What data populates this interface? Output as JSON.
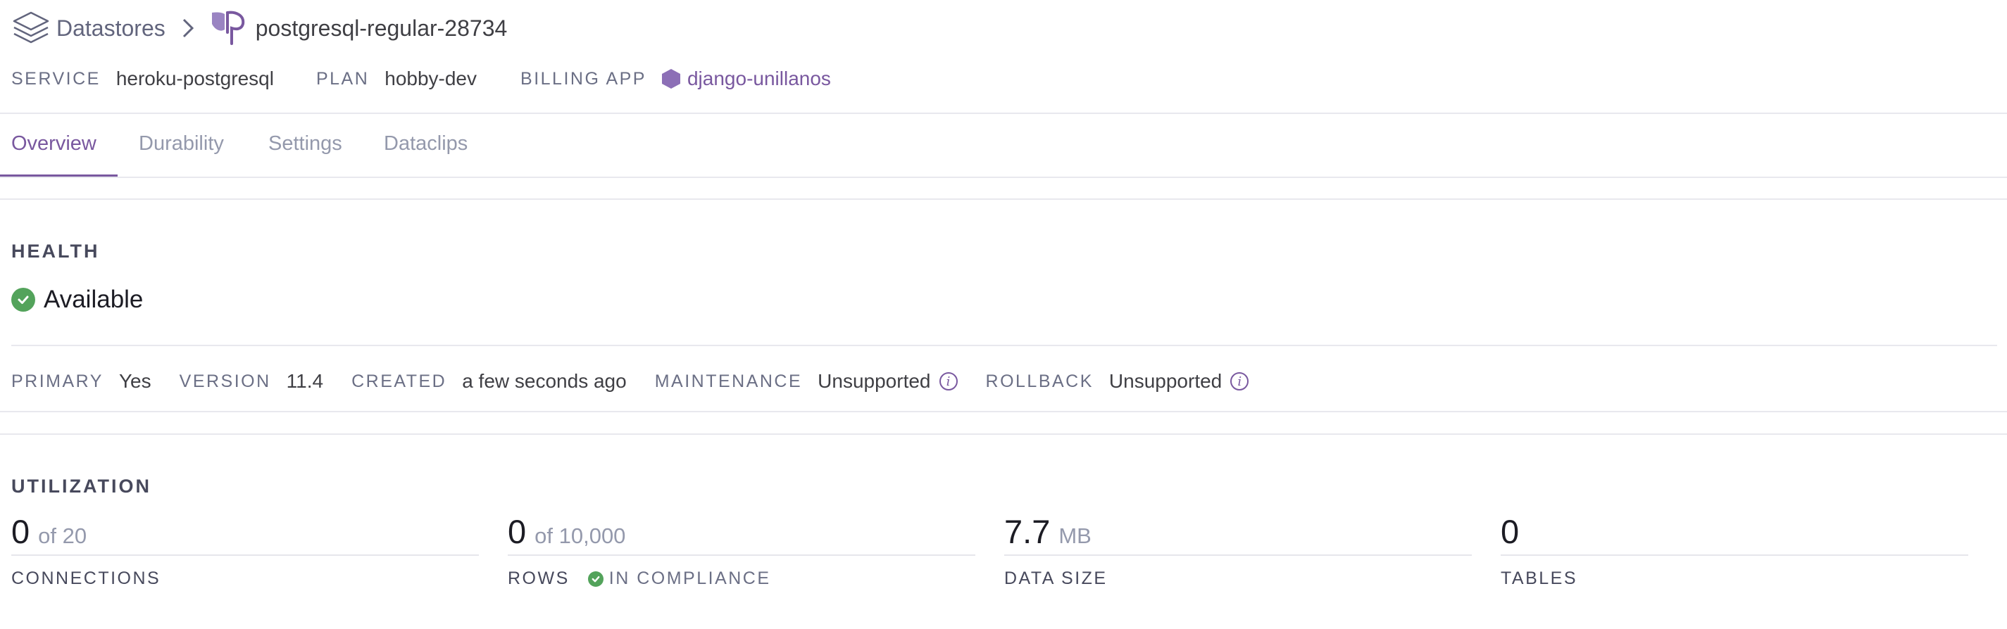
{
  "breadcrumb": {
    "datastores_label": "Datastores",
    "separator": ">",
    "resource_name": "postgresql-regular-28734"
  },
  "meta": {
    "service_label": "SERVICE",
    "service_value": "heroku-postgresql",
    "plan_label": "PLAN",
    "plan_value": "hobby-dev",
    "billing_app_label": "BILLING APP",
    "billing_app_value": "django-unillanos"
  },
  "tabs": [
    {
      "label": "Overview",
      "active": true
    },
    {
      "label": "Durability",
      "active": false
    },
    {
      "label": "Settings",
      "active": false
    },
    {
      "label": "Dataclips",
      "active": false
    }
  ],
  "health": {
    "title": "HEALTH",
    "status": "Available",
    "status_color": "#53a35b"
  },
  "details": {
    "primary_label": "PRIMARY",
    "primary_value": "Yes",
    "version_label": "VERSION",
    "version_value": "11.4",
    "created_label": "CREATED",
    "created_value": "a few seconds ago",
    "maintenance_label": "MAINTENANCE",
    "maintenance_value": "Unsupported",
    "rollback_label": "ROLLBACK",
    "rollback_value": "Unsupported"
  },
  "utilization": {
    "title": "UTILIZATION",
    "connections": {
      "value": "0",
      "suffix": "of 20",
      "label": "CONNECTIONS"
    },
    "rows": {
      "value": "0",
      "suffix": "of 10,000",
      "label": "ROWS",
      "compliance": "IN COMPLIANCE"
    },
    "data_size": {
      "value": "7.7",
      "suffix": "MB",
      "label": "DATA SIZE"
    },
    "tables": {
      "value": "0",
      "label": "TABLES"
    }
  },
  "colors": {
    "accent": "#79589f",
    "success": "#53a35b",
    "muted": "#9499ac"
  }
}
